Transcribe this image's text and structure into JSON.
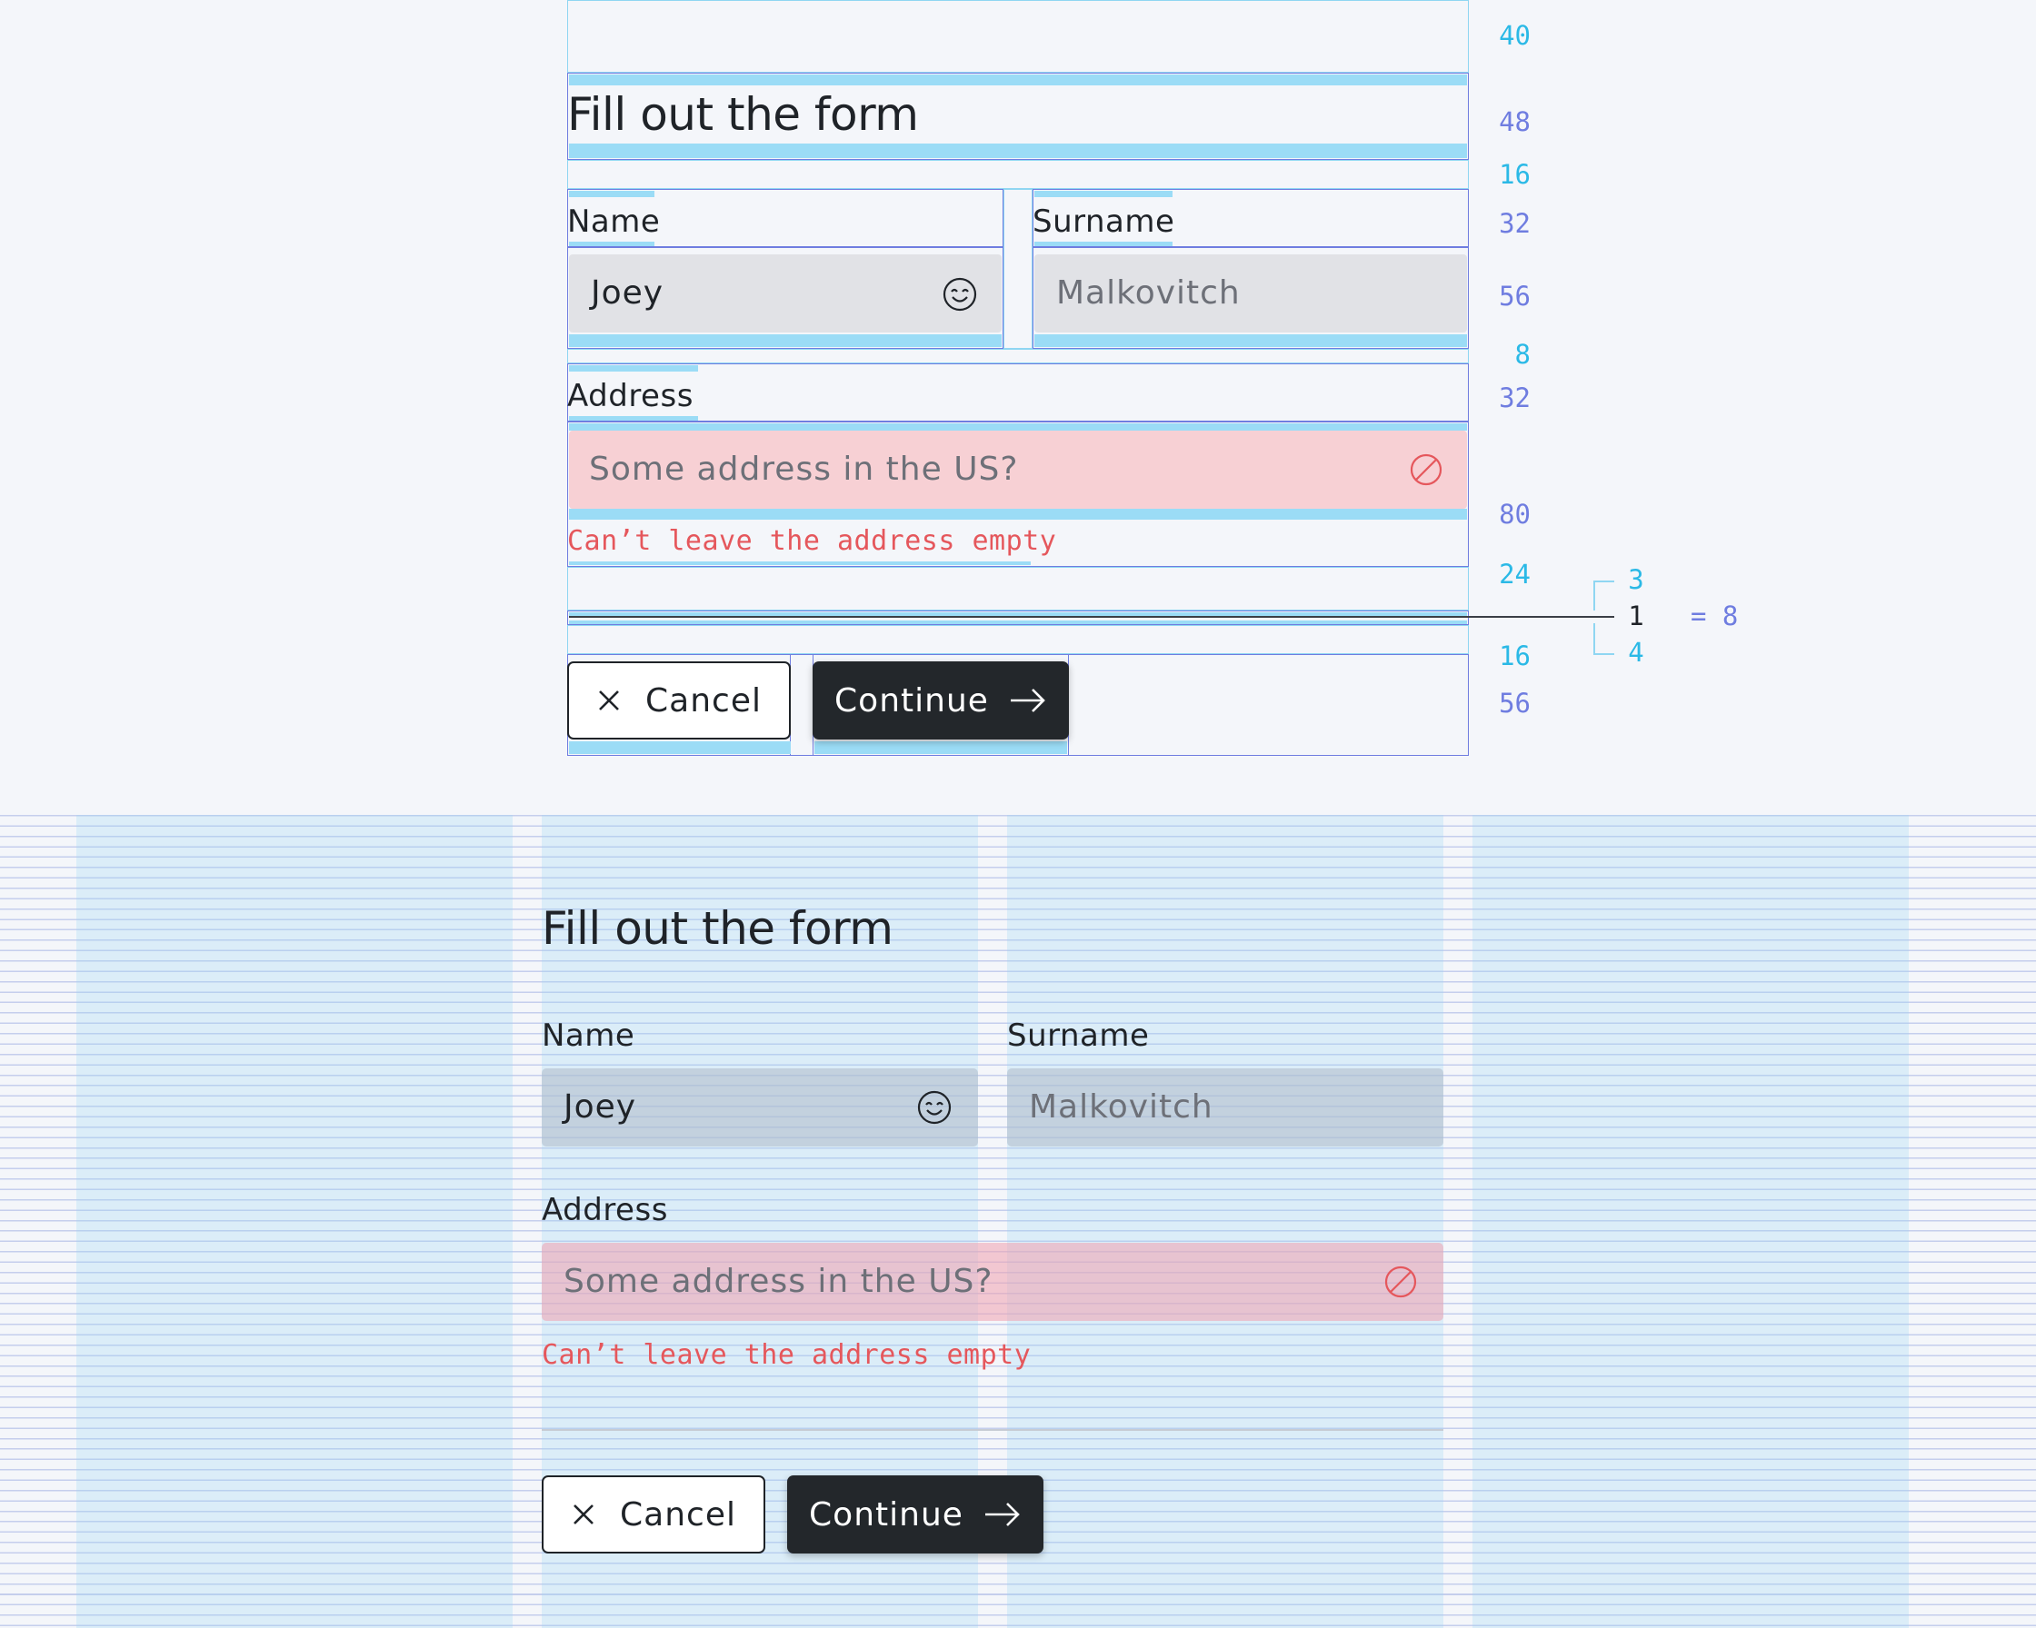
{
  "form": {
    "title": "Fill out the form",
    "name_label": "Name",
    "name_value": "Joey",
    "name_icon": "smiley-icon",
    "surname_label": "Surname",
    "surname_placeholder": "Malkovitch",
    "address_label": "Address",
    "address_placeholder": "Some address in the US?",
    "address_icon": "blocked-icon",
    "address_error": "Can’t leave the address empty",
    "cancel_label": "Cancel",
    "continue_label": "Continue"
  },
  "spacing": {
    "values": [
      "40",
      "48",
      "16",
      "32",
      "56",
      "8",
      "32",
      "80",
      "24",
      "16",
      "56"
    ],
    "divider_breakdown": [
      "3",
      "1",
      "4"
    ],
    "divider_total": "= 8"
  },
  "colors": {
    "error": "#e5575c",
    "primary_button": "#23272b",
    "input_background": "#e1e2e6",
    "error_background": "#f7d0d4",
    "spacing_cyan": "#2bb9e6",
    "spacing_purple": "#6f7de0"
  }
}
